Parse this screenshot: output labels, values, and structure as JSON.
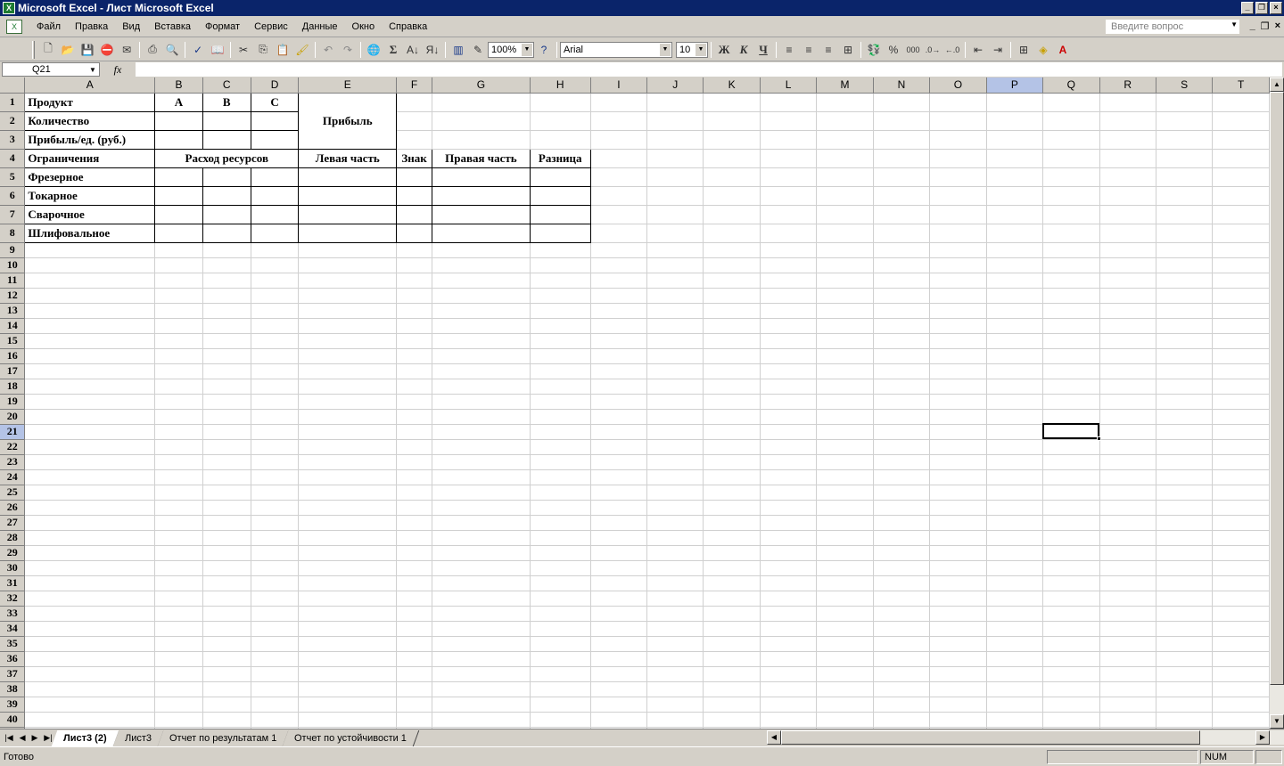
{
  "window": {
    "title": "Microsoft Excel - Лист Microsoft Excel",
    "app_icon": "excel-icon"
  },
  "menu": {
    "items": [
      "Файл",
      "Правка",
      "Вид",
      "Вставка",
      "Формат",
      "Сервис",
      "Данные",
      "Окно",
      "Справка"
    ],
    "question_placeholder": "Введите вопрос"
  },
  "toolbar": {
    "zoom": "100%",
    "font": "Arial",
    "size": "10",
    "bold": "Ж",
    "italic": "К",
    "underline": "Ч",
    "sum": "Σ",
    "percent": "%",
    "thousands": "000"
  },
  "formula_bar": {
    "name_box": "Q21",
    "fx": "fx",
    "formula": ""
  },
  "columns": [
    "A",
    "B",
    "C",
    "D",
    "E",
    "F",
    "G",
    "H",
    "I",
    "J",
    "K",
    "L",
    "M",
    "N",
    "O",
    "P",
    "Q",
    "R",
    "S",
    "T"
  ],
  "selected": {
    "column": "Q",
    "row": 21
  },
  "cells": {
    "A1": "Продукт",
    "B1": "A",
    "C1": "B",
    "D1": "C",
    "E1": "Прибыль",
    "A2": "Количество",
    "A3": "Прибыль/ед. (руб.)",
    "A4": "Ограничения",
    "B4": "Расход ресурсов",
    "E4": "Левая часть",
    "F4": "Знак",
    "G4": "Правая часть",
    "H4": "Разница",
    "A5": "Фрезерное",
    "A6": "Токарное",
    "A7": "Сварочное",
    "A8": "Шлифовальное"
  },
  "sheet_tabs": [
    "Лист3 (2)",
    "Лист3",
    "Отчет по результатам 1",
    "Отчет по устойчивости 1"
  ],
  "active_tab": "Лист3 (2)",
  "status": {
    "text": "Готово",
    "num": "NUM"
  }
}
